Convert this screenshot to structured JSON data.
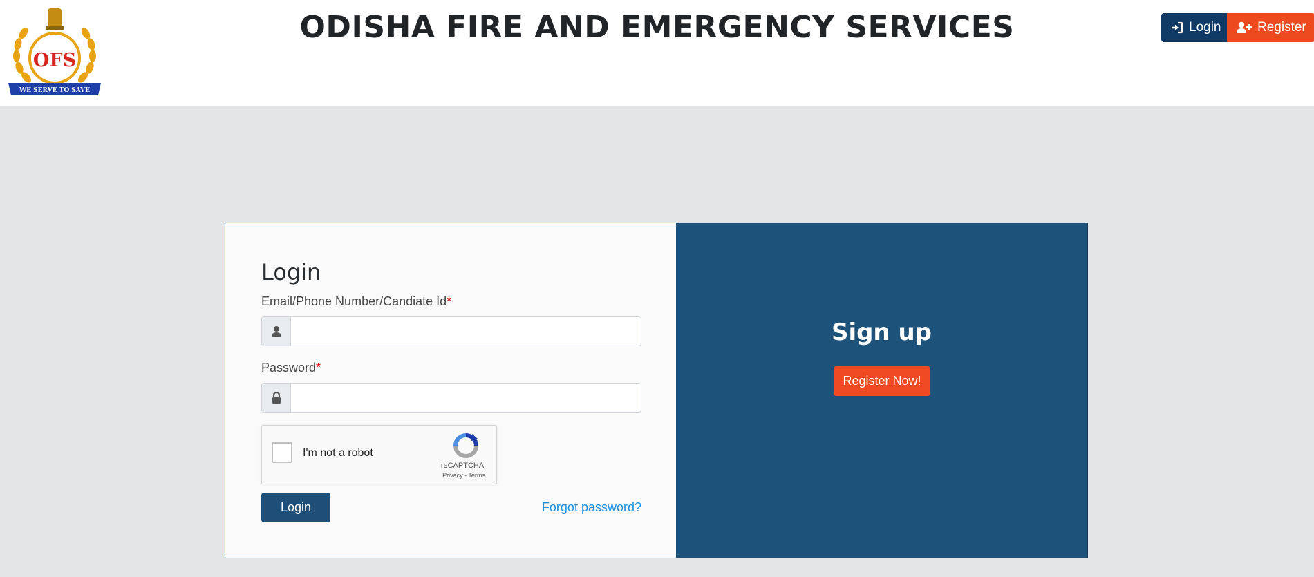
{
  "header": {
    "title": "ODISHA FIRE AND EMERGENCY SERVICES",
    "logo": {
      "text": "OFS",
      "motto": "WE SERVE TO SAVE",
      "icon": "ofs-emblem"
    },
    "login_label": "Login",
    "register_label": "Register"
  },
  "login_form": {
    "title": "Login",
    "username_label": "Email/Phone Number/Candiate Id",
    "password_label": "Password",
    "required_mark": "*",
    "username_value": "",
    "password_value": "",
    "captcha_label": "I'm not a robot",
    "captcha_brand": "reCAPTCHA",
    "captcha_links": "Privacy - Terms",
    "submit_label": "Login",
    "forgot_label": "Forgot password?"
  },
  "signup_panel": {
    "title": "Sign up",
    "button_label": "Register Now!"
  },
  "colors": {
    "navy": "#0f3a65",
    "orange": "#ee4a1f",
    "panel_blue": "#1d527b",
    "background": "#e4e5e7"
  }
}
